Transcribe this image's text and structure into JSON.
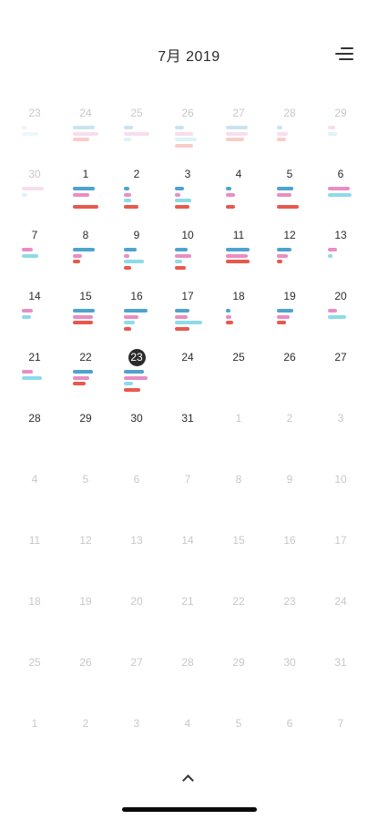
{
  "header": {
    "title": "7月 2019"
  },
  "icons": {
    "menu": "menu-lines-icon",
    "expand": "chevron-up-icon"
  },
  "colors": {
    "blue": "#4ea3cf",
    "pink": "#e88ec3",
    "cyan": "#8cdbe8",
    "red": "#e8594d",
    "lightblue": "#bfe3f2",
    "lightpink": "#f4c6df",
    "today": "#2b2b2b"
  },
  "weeks": [
    [
      {
        "label": "23",
        "faded": true,
        "bars": [
          [
            "lightpink",
            5
          ],
          [
            "lightblue",
            18
          ]
        ]
      },
      {
        "label": "24",
        "faded": true,
        "bars": [
          [
            "blue",
            24
          ],
          [
            "pink",
            28
          ],
          [
            "red",
            18
          ]
        ]
      },
      {
        "label": "25",
        "faded": true,
        "bars": [
          [
            "blue",
            10
          ],
          [
            "pink",
            28
          ],
          [
            "cyan",
            8
          ]
        ]
      },
      {
        "label": "26",
        "faded": true,
        "bars": [
          [
            "blue",
            10
          ],
          [
            "pink",
            20
          ],
          [
            "cyan",
            24
          ],
          [
            "red",
            20
          ]
        ]
      },
      {
        "label": "27",
        "faded": true,
        "bars": [
          [
            "blue",
            24
          ],
          [
            "pink",
            24
          ],
          [
            "red",
            20
          ]
        ]
      },
      {
        "label": "28",
        "faded": true,
        "bars": [
          [
            "blue",
            6
          ],
          [
            "pink",
            12
          ],
          [
            "red",
            10
          ]
        ]
      },
      {
        "label": "29",
        "faded": true,
        "bars": [
          [
            "pink",
            8
          ],
          [
            "cyan",
            10
          ]
        ]
      }
    ],
    [
      {
        "label": "30",
        "faded": true,
        "bars": [
          [
            "pink",
            24
          ],
          [
            "cyan",
            6
          ]
        ]
      },
      {
        "label": "1",
        "faded": false,
        "bars": [
          [
            "blue",
            24
          ],
          [
            "pink",
            18
          ],
          [
            "cyan",
            0
          ],
          [
            "red",
            28
          ]
        ]
      },
      {
        "label": "2",
        "faded": false,
        "bars": [
          [
            "blue",
            6
          ],
          [
            "pink",
            8
          ],
          [
            "cyan",
            8
          ],
          [
            "red",
            16
          ]
        ]
      },
      {
        "label": "3",
        "faded": false,
        "bars": [
          [
            "blue",
            10
          ],
          [
            "pink",
            6
          ],
          [
            "cyan",
            18
          ],
          [
            "red",
            16
          ]
        ]
      },
      {
        "label": "4",
        "faded": false,
        "bars": [
          [
            "blue",
            6
          ],
          [
            "pink",
            10
          ],
          [
            "cyan",
            0
          ],
          [
            "red",
            10
          ]
        ]
      },
      {
        "label": "5",
        "faded": false,
        "bars": [
          [
            "blue",
            18
          ],
          [
            "pink",
            16
          ],
          [
            "cyan",
            0
          ],
          [
            "red",
            24
          ]
        ]
      },
      {
        "label": "6",
        "faded": false,
        "bars": [
          [
            "pink",
            24
          ],
          [
            "cyan",
            26
          ]
        ]
      }
    ],
    [
      {
        "label": "7",
        "faded": false,
        "bars": [
          [
            "pink",
            12
          ],
          [
            "cyan",
            18
          ]
        ]
      },
      {
        "label": "8",
        "faded": false,
        "bars": [
          [
            "blue",
            24
          ],
          [
            "pink",
            10
          ],
          [
            "red",
            8
          ]
        ]
      },
      {
        "label": "9",
        "faded": false,
        "bars": [
          [
            "blue",
            14
          ],
          [
            "pink",
            6
          ],
          [
            "cyan",
            22
          ],
          [
            "red",
            8
          ]
        ]
      },
      {
        "label": "10",
        "faded": false,
        "bars": [
          [
            "blue",
            14
          ],
          [
            "pink",
            18
          ],
          [
            "cyan",
            8
          ],
          [
            "red",
            12
          ]
        ]
      },
      {
        "label": "11",
        "faded": false,
        "bars": [
          [
            "blue",
            26
          ],
          [
            "pink",
            24
          ],
          [
            "red",
            26
          ]
        ]
      },
      {
        "label": "12",
        "faded": false,
        "bars": [
          [
            "blue",
            16
          ],
          [
            "pink",
            12
          ],
          [
            "red",
            6
          ]
        ]
      },
      {
        "label": "13",
        "faded": false,
        "bars": [
          [
            "pink",
            10
          ],
          [
            "cyan",
            5
          ]
        ]
      }
    ],
    [
      {
        "label": "14",
        "faded": false,
        "bars": [
          [
            "pink",
            12
          ],
          [
            "cyan",
            10
          ]
        ]
      },
      {
        "label": "15",
        "faded": false,
        "bars": [
          [
            "blue",
            24
          ],
          [
            "pink",
            22
          ],
          [
            "red",
            22
          ]
        ]
      },
      {
        "label": "16",
        "faded": false,
        "bars": [
          [
            "blue",
            26
          ],
          [
            "pink",
            16
          ],
          [
            "cyan",
            12
          ],
          [
            "red",
            8
          ]
        ]
      },
      {
        "label": "17",
        "faded": false,
        "bars": [
          [
            "blue",
            16
          ],
          [
            "pink",
            14
          ],
          [
            "cyan",
            30
          ],
          [
            "red",
            16
          ]
        ]
      },
      {
        "label": "18",
        "faded": false,
        "bars": [
          [
            "blue",
            5
          ],
          [
            "pink",
            6
          ],
          [
            "red",
            8
          ]
        ]
      },
      {
        "label": "19",
        "faded": false,
        "bars": [
          [
            "blue",
            18
          ],
          [
            "pink",
            14
          ],
          [
            "red",
            10
          ]
        ]
      },
      {
        "label": "20",
        "faded": false,
        "bars": [
          [
            "pink",
            10
          ],
          [
            "cyan",
            20
          ]
        ]
      }
    ],
    [
      {
        "label": "21",
        "faded": false,
        "bars": [
          [
            "pink",
            12
          ],
          [
            "cyan",
            22
          ]
        ]
      },
      {
        "label": "22",
        "faded": false,
        "bars": [
          [
            "blue",
            22
          ],
          [
            "pink",
            18
          ],
          [
            "red",
            14
          ]
        ]
      },
      {
        "label": "23",
        "faded": false,
        "today": true,
        "bars": [
          [
            "blue",
            22
          ],
          [
            "pink",
            26
          ],
          [
            "cyan",
            10
          ],
          [
            "red",
            18
          ]
        ]
      },
      {
        "label": "24",
        "faded": false,
        "bars": []
      },
      {
        "label": "25",
        "faded": false,
        "bars": []
      },
      {
        "label": "26",
        "faded": false,
        "bars": []
      },
      {
        "label": "27",
        "faded": false,
        "bars": []
      }
    ],
    [
      {
        "label": "28",
        "faded": false,
        "bars": []
      },
      {
        "label": "29",
        "faded": false,
        "bars": []
      },
      {
        "label": "30",
        "faded": false,
        "bars": []
      },
      {
        "label": "31",
        "faded": false,
        "bars": []
      },
      {
        "label": "1",
        "faded": true,
        "bars": []
      },
      {
        "label": "2",
        "faded": true,
        "bars": []
      },
      {
        "label": "3",
        "faded": true,
        "bars": []
      }
    ],
    [
      {
        "label": "4",
        "faded": true,
        "bars": []
      },
      {
        "label": "5",
        "faded": true,
        "bars": []
      },
      {
        "label": "6",
        "faded": true,
        "bars": []
      },
      {
        "label": "7",
        "faded": true,
        "bars": []
      },
      {
        "label": "8",
        "faded": true,
        "bars": []
      },
      {
        "label": "9",
        "faded": true,
        "bars": []
      },
      {
        "label": "10",
        "faded": true,
        "bars": []
      }
    ],
    [
      {
        "label": "11",
        "faded": true,
        "bars": []
      },
      {
        "label": "12",
        "faded": true,
        "bars": []
      },
      {
        "label": "13",
        "faded": true,
        "bars": []
      },
      {
        "label": "14",
        "faded": true,
        "bars": []
      },
      {
        "label": "15",
        "faded": true,
        "bars": []
      },
      {
        "label": "16",
        "faded": true,
        "bars": []
      },
      {
        "label": "17",
        "faded": true,
        "bars": []
      }
    ],
    [
      {
        "label": "18",
        "faded": true,
        "bars": []
      },
      {
        "label": "19",
        "faded": true,
        "bars": []
      },
      {
        "label": "20",
        "faded": true,
        "bars": []
      },
      {
        "label": "21",
        "faded": true,
        "bars": []
      },
      {
        "label": "22",
        "faded": true,
        "bars": []
      },
      {
        "label": "23",
        "faded": true,
        "bars": []
      },
      {
        "label": "24",
        "faded": true,
        "bars": []
      }
    ],
    [
      {
        "label": "25",
        "faded": true,
        "bars": []
      },
      {
        "label": "26",
        "faded": true,
        "bars": []
      },
      {
        "label": "27",
        "faded": true,
        "bars": []
      },
      {
        "label": "28",
        "faded": true,
        "bars": []
      },
      {
        "label": "29",
        "faded": true,
        "bars": []
      },
      {
        "label": "30",
        "faded": true,
        "bars": []
      },
      {
        "label": "31",
        "faded": true,
        "bars": []
      }
    ],
    [
      {
        "label": "1",
        "faded": true,
        "bars": []
      },
      {
        "label": "2",
        "faded": true,
        "bars": []
      },
      {
        "label": "3",
        "faded": true,
        "bars": []
      },
      {
        "label": "4",
        "faded": true,
        "bars": []
      },
      {
        "label": "5",
        "faded": true,
        "bars": []
      },
      {
        "label": "6",
        "faded": true,
        "bars": []
      },
      {
        "label": "7",
        "faded": true,
        "bars": []
      }
    ]
  ]
}
